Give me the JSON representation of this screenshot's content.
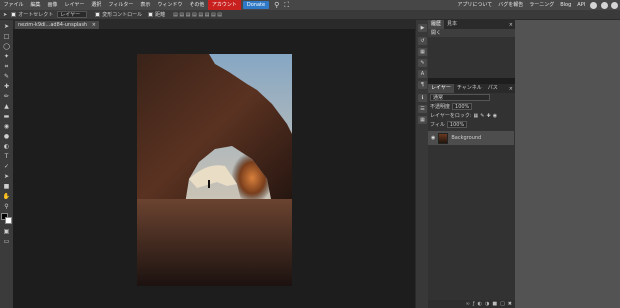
{
  "menubar": {
    "items": [
      "ファイル",
      "編集",
      "画像",
      "レイヤー",
      "選択",
      "フィルター",
      "表示",
      "ウィンドウ",
      "その他"
    ],
    "account": "アカウント",
    "donate": "Donate",
    "right_items": [
      "アプリについて",
      "バグを報告",
      "ラーニング",
      "Blog",
      "API"
    ],
    "icons": [
      "search-icon",
      "fullscreen-icon",
      "reddit-icon",
      "twitter-icon",
      "facebook-icon"
    ]
  },
  "options": {
    "autoselect": "オートセレクト",
    "layer_select": "レイヤー",
    "transform": "変形コントロール",
    "distance": "距離"
  },
  "document": {
    "tab_title": "nezim-k9di...ad84-unsplash",
    "tab_close": "×"
  },
  "panels": {
    "history": {
      "tabs": [
        "履歴",
        "見本"
      ],
      "rows": [
        "開く"
      ],
      "close": "×"
    },
    "layers": {
      "tabs": [
        "レイヤー",
        "チャンネル",
        "パス"
      ],
      "close": "×",
      "blend_mode": "通常",
      "opacity_label": "不透明度",
      "opacity_value": "100%",
      "lock_label": "レイヤーをロック:",
      "fill_label": "フィル",
      "fill_value": "100%",
      "layer_name": "Background",
      "footer_icons": [
        "link-icon",
        "fx-icon",
        "mask-icon",
        "adjustment-icon",
        "folder-icon",
        "new-layer-icon",
        "trash-icon"
      ]
    }
  },
  "colors": {
    "menubar": "#474747",
    "account": "#c8201e",
    "donate": "#2f79c7",
    "canvas_bg": "#1d1d1d",
    "panel_bg": "#323232"
  }
}
